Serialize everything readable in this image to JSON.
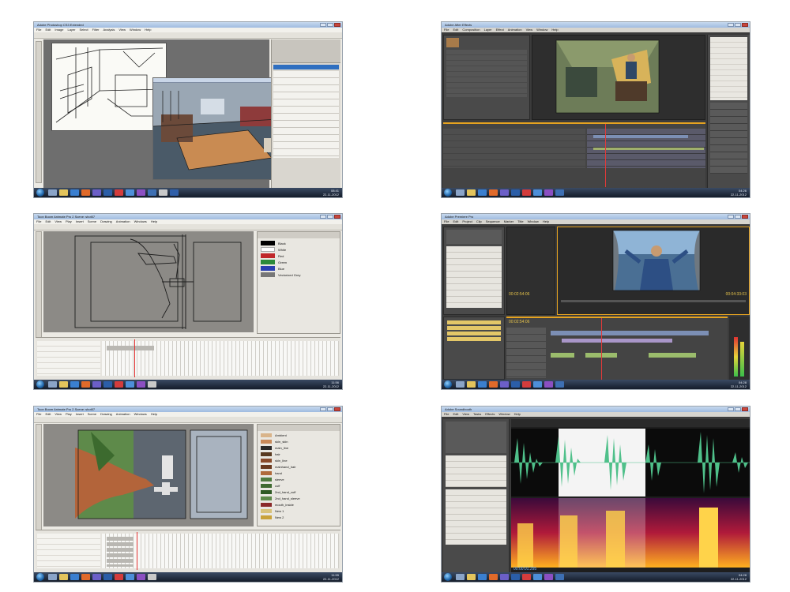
{
  "panels": {
    "photoshop": {
      "title": "Adobe Photoshop CS3 Extended",
      "menu": [
        "File",
        "Edit",
        "Image",
        "Layer",
        "Select",
        "Filter",
        "Analysis",
        "View",
        "Window",
        "Help"
      ],
      "clock": "08:41",
      "date": "22-11-2012"
    },
    "after_effects": {
      "title": "Adobe After Effects",
      "menu": [
        "File",
        "Edit",
        "Composition",
        "Layer",
        "Effect",
        "Animation",
        "View",
        "Window",
        "Help"
      ],
      "clock": "04:26",
      "date": "22-11-2012"
    },
    "toonboom_1": {
      "title": "Toon Boom Animate Pro 2 Scene: shot07",
      "menu": [
        "File",
        "Edit",
        "View",
        "Play",
        "Insert",
        "Scene",
        "Drawing",
        "Animation",
        "Windows",
        "Help"
      ],
      "colors": [
        "Black",
        "White",
        "Red",
        "Green",
        "Blue",
        "Vectorized Grey"
      ],
      "clock": "11:56",
      "date": "22-11-2012"
    },
    "premiere": {
      "title": "Adobe Premiere Pro",
      "menu": [
        "File",
        "Edit",
        "Project",
        "Clip",
        "Sequence",
        "Marker",
        "Title",
        "Window",
        "Help"
      ],
      "timecode_left": "00:02:54:06",
      "timecode_right": "00:04:33:03",
      "seq_timecode": "00:02:54:06",
      "clock": "04:28",
      "date": "22-11-2012"
    },
    "toonboom_2": {
      "title": "Toon Boom Animate Pro 2 Scene: shot07",
      "menu": [
        "File",
        "Edit",
        "View",
        "Play",
        "Insert",
        "Scene",
        "Drawing",
        "Animation",
        "Windows",
        "Help"
      ],
      "colors": [
        "Ambient",
        "skin_skin",
        "main_line",
        "hair",
        "skin_line",
        "mainhand_hair",
        "hand",
        "sleeve",
        "cuff",
        "2nd_hand_cuff",
        "2nd_hand_sleeve",
        "mouth_inside",
        "New 1",
        "New 2"
      ],
      "clock": "11:55",
      "date": "22-11-2012"
    },
    "soundbooth": {
      "title": "Adobe Soundbooth",
      "menu": [
        "File",
        "Edit",
        "View",
        "Tasks",
        "Effects",
        "Window",
        "Help"
      ],
      "timecode": "00:00:01.295",
      "clock": "04:28",
      "date": "22-11-2012"
    }
  },
  "colors": {
    "titlebar": "#a9c3e4",
    "taskbar": "#1c2536",
    "ps_canvas": "#6e6e6e",
    "ae_panel": "#3b3b3b",
    "tb_canvas": "#8c8a86",
    "waveform": "#4fc08a",
    "spectrogram_hot": "#ffb020"
  }
}
